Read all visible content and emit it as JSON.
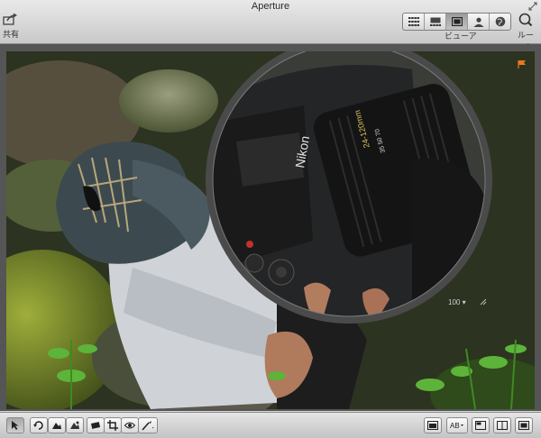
{
  "window": {
    "title": "Aperture"
  },
  "toolbar": {
    "share_label": "共有",
    "view_label": "ビューア",
    "loupe_label": "ルーペ",
    "view_modes": [
      {
        "name": "browser-grid",
        "icon": "grid-icon",
        "active": false
      },
      {
        "name": "split-view",
        "icon": "split-view-icon",
        "active": false
      },
      {
        "name": "viewer",
        "icon": "viewer-icon",
        "active": true
      },
      {
        "name": "faces",
        "icon": "person-icon",
        "active": false
      },
      {
        "name": "places",
        "icon": "globe-icon",
        "active": false
      }
    ]
  },
  "viewer": {
    "loupe_zoom": "100",
    "flag_color": "#e67a1e"
  },
  "statusbar": {
    "tools": [
      "select-icon",
      "rotate-icon",
      "lift-icon",
      "stamp-icon",
      "straighten-icon",
      "crop-icon",
      "redeye-icon",
      "brush-icon"
    ],
    "right_controls": [
      "single-viewer-icon",
      "multi-viewer-icon",
      "dual-panel-icon",
      "split-panel-icon",
      "fullscreen-icon"
    ]
  }
}
